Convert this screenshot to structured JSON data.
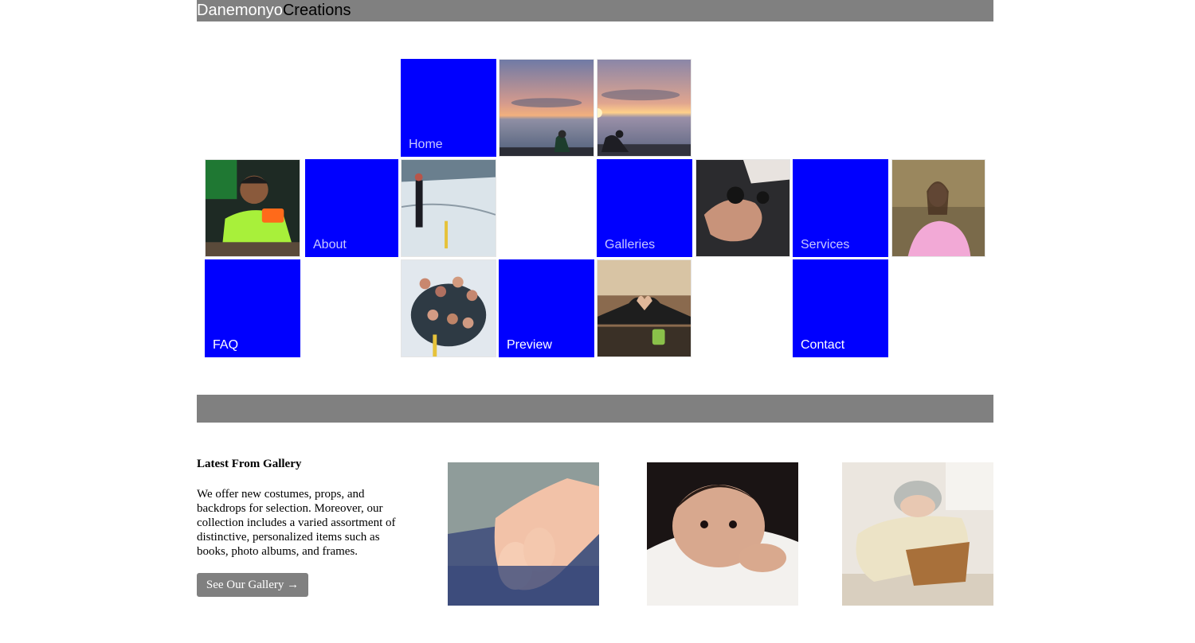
{
  "brand": {
    "part1": "Danemonyo",
    "part2": "Creations"
  },
  "nav": {
    "home": "Home",
    "about": "About",
    "galleries": "Galleries",
    "services": "Services",
    "faq": "FAQ",
    "preview": "Preview",
    "contact": "Contact"
  },
  "colors": {
    "nav_tile": "#0000ff",
    "bars": "#808080"
  },
  "photos": {
    "sunset_a": "sunset-person-photo",
    "sunset_b": "sunset-person-photo",
    "man_green_hoodie": "man-with-mug-photo",
    "ice_snow": "person-on-ice-photo",
    "holding_hands": "holding-hands-photo",
    "woman_pink_dress": "woman-pink-dress-photo",
    "ice_swim_group": "ice-swim-group-photo",
    "heart_hands": "heart-hands-photo"
  },
  "latest": {
    "title": "Latest From Gallery",
    "body": "We offer new costumes, props, and backdrops for selection. Moreover, our collection includes a varied assortment of distinctive, personalized items such as books, photo albums, and frames.",
    "button": "See Our Gallery →",
    "thumbs": [
      "baby-feet-photo",
      "newborn-face-photo",
      "baby-in-basket-photo"
    ]
  }
}
